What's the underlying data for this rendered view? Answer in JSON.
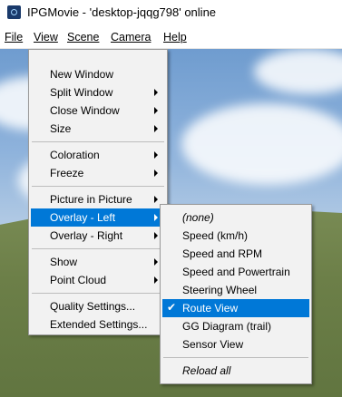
{
  "window": {
    "title": "IPGMovie - 'desktop-jqqg798' online"
  },
  "menubar": [
    {
      "label": "File"
    },
    {
      "label": "View"
    },
    {
      "label": "Scene"
    },
    {
      "label": "Camera"
    },
    {
      "label": "Help"
    }
  ],
  "view_menu": {
    "items": [
      {
        "label": "New Window",
        "has_submenu": false
      },
      {
        "label": "Split Window",
        "has_submenu": true
      },
      {
        "label": "Close Window",
        "has_submenu": true
      },
      {
        "label": "Size",
        "has_submenu": true
      },
      {
        "label": "Coloration",
        "has_submenu": true
      },
      {
        "label": "Freeze",
        "has_submenu": true
      },
      {
        "label": "Picture in Picture",
        "has_submenu": true
      },
      {
        "label": "Overlay - Left",
        "has_submenu": true,
        "selected": true
      },
      {
        "label": "Overlay - Right",
        "has_submenu": true
      },
      {
        "label": "Show",
        "has_submenu": true
      },
      {
        "label": "Point Cloud",
        "has_submenu": true
      },
      {
        "label": "Quality Settings...",
        "has_submenu": false
      },
      {
        "label": "Extended Settings...",
        "has_submenu": false
      }
    ]
  },
  "overlay_submenu": {
    "items": [
      {
        "label": "(none)",
        "italic": true
      },
      {
        "label": "Speed (km/h)"
      },
      {
        "label": "Speed and RPM"
      },
      {
        "label": "Speed and Powertrain"
      },
      {
        "label": "Steering Wheel"
      },
      {
        "label": "Route View",
        "checked": true,
        "selected": true
      },
      {
        "label": "GG Diagram (trail)"
      },
      {
        "label": "Sensor View"
      },
      {
        "label": "Reload all",
        "italic": true
      }
    ],
    "check_glyph": "✔"
  },
  "colors": {
    "highlight": "#0078d7",
    "menu_bg": "#f2f2f2"
  }
}
